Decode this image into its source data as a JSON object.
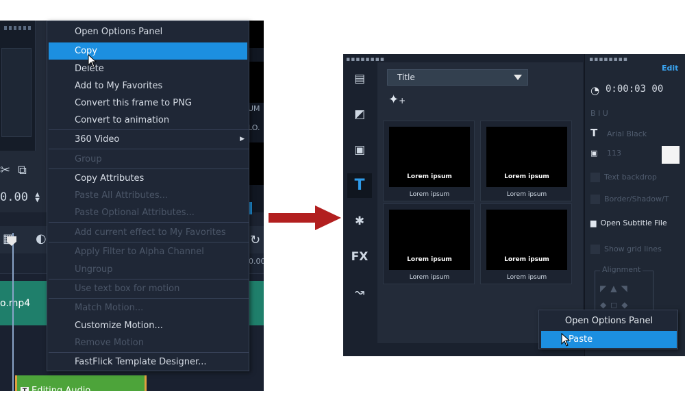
{
  "left_panel": {
    "timecode": "0.00",
    "side_text_1": "UM",
    "side_text_2": "LO.",
    "ruler_text": "0.00",
    "video_clip_label": "o.mp4",
    "audio_clip_label": "Editing Audio",
    "audio_badge": "T"
  },
  "context_menu_left": {
    "items": [
      {
        "label": "Open Options Panel",
        "enabled": true
      },
      {
        "label": "Copy",
        "enabled": true,
        "highlighted": true
      },
      {
        "label": "Delete",
        "enabled": true
      },
      {
        "label": "Add to My Favorites",
        "enabled": true
      },
      {
        "label": "Convert this frame to PNG",
        "enabled": true
      },
      {
        "label": "Convert to animation",
        "enabled": true
      },
      {
        "label": "360 Video",
        "enabled": true,
        "submenu": true
      },
      {
        "label": "Group",
        "enabled": false
      },
      {
        "label": "Copy Attributes",
        "enabled": true
      },
      {
        "label": "Paste All Attributes...",
        "enabled": false
      },
      {
        "label": "Paste Optional Attributes...",
        "enabled": false
      },
      {
        "label": "Add current effect to My Favorites",
        "enabled": false
      },
      {
        "label": "Apply Filter to Alpha Channel",
        "enabled": false
      },
      {
        "label": "Ungroup",
        "enabled": false
      },
      {
        "label": "Use text box for motion",
        "enabled": false
      },
      {
        "label": "Match Motion...",
        "enabled": false
      },
      {
        "label": "Customize Motion...",
        "enabled": true
      },
      {
        "label": "Remove Motion",
        "enabled": false
      },
      {
        "label": "FastFlick Template Designer...",
        "enabled": true
      }
    ]
  },
  "right_panel": {
    "library": {
      "dropdown_value": "Title",
      "tiles": [
        {
          "inner_text": "Lorem ipsum",
          "caption": "Lorem ipsum"
        },
        {
          "inner_text": "Lorem ipsum",
          "caption": "Lorem ipsum"
        },
        {
          "inner_text": "Lorem ipsum",
          "caption": "Lorem ipsum"
        },
        {
          "inner_text": "Lorem ipsum",
          "caption": "Lorem ipsum"
        }
      ],
      "sidebar_fx_label": "FX",
      "sidebar_active": "title-tool"
    },
    "options": {
      "edit_tab": "Edit",
      "duration": "0:00:03 00",
      "font_name": "Arial Black",
      "font_size": "113",
      "text_backdrop": "Text backdrop",
      "border_shadow": "Border/Shadow/T",
      "open_subtitle": "Open Subtitle File",
      "show_grid": "Show grid lines",
      "alignment": "Alignment",
      "style_buttons": "B  I  U"
    }
  },
  "context_menu_right": {
    "items": [
      {
        "label": "Open Options Panel",
        "enabled": true
      },
      {
        "label": "Paste",
        "enabled": true,
        "highlighted": true
      }
    ]
  },
  "colors": {
    "highlight": "#1c8fe0",
    "arrow": "#b21f1f",
    "video_track": "#1f7f6b",
    "audio_clip": "#4da43a",
    "active_tool": "#2f9be8"
  }
}
